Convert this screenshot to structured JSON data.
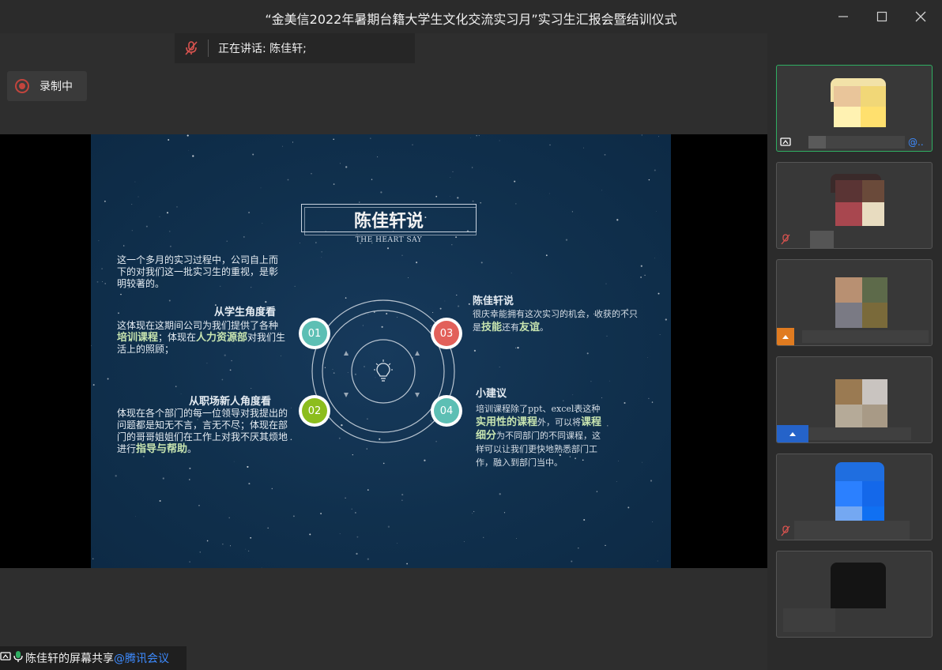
{
  "window": {
    "title": "“金美信2022年暑期台籍大学生文化交流实习月”实习生汇报会暨结训仪式"
  },
  "speaking": {
    "text": "正在讲话: 陈佳轩;"
  },
  "recording": {
    "label": "录制中"
  },
  "slide": {
    "title": "陈佳轩说",
    "subtitle": "THE HEART SAY",
    "intro": "这一个多月的实习过程中，公司自上而下的对我们这一批实习生的重视，是彰明较著的。",
    "section1": {
      "heading": "从学生角度看",
      "text_a": "这体现在这期间公司为我们提供了各种",
      "hl_a": "培训课程",
      "text_b": "；体现在",
      "hl_b": "人力资源部",
      "text_c": "对我们生活上的照顾；"
    },
    "section2": {
      "heading": "从职场新人角度看",
      "text_a": "体现在各个部门的每一位领导对我提出的问题都是知无不言，言无不尽；体现在部门的哥哥姐姐们在工作上对我不厌其烦地进行",
      "hl_a": "指导与帮助",
      "text_b": "。"
    },
    "section3": {
      "heading": "陈佳轩说",
      "text_a": "很庆幸能拥有这次实习的机会，收获的不只是",
      "hl_a": "技能",
      "text_b": "还有",
      "hl_b": "友谊",
      "text_c": "。"
    },
    "section4": {
      "heading": "小建议",
      "text_a": "培训课程除了ppt、excel表这种",
      "hl_a": "实用性的课程",
      "text_b": "外，可以将",
      "hl_b": "课程细分",
      "text_c": "为不同部门的不同课程，这样可以让我们更快地熟悉部门工作，融入到部门当中。"
    },
    "badges": [
      "01",
      "02",
      "03",
      "04"
    ],
    "colors": {
      "b01": "#5dbfb4",
      "b02": "#8cbd1e",
      "b03": "#e2605a",
      "b04": "#5dbfb4"
    }
  },
  "bottom": {
    "share_text": "陈佳轩的屏幕共享",
    "brand": "@腾讯会议"
  },
  "participants": [
    {
      "id": "p1",
      "active": true,
      "name_suffix": "@.."
    },
    {
      "id": "p2",
      "active": false
    },
    {
      "id": "p3",
      "active": false
    },
    {
      "id": "p4",
      "active": false
    },
    {
      "id": "p5",
      "active": false
    },
    {
      "id": "p6",
      "active": false
    }
  ]
}
